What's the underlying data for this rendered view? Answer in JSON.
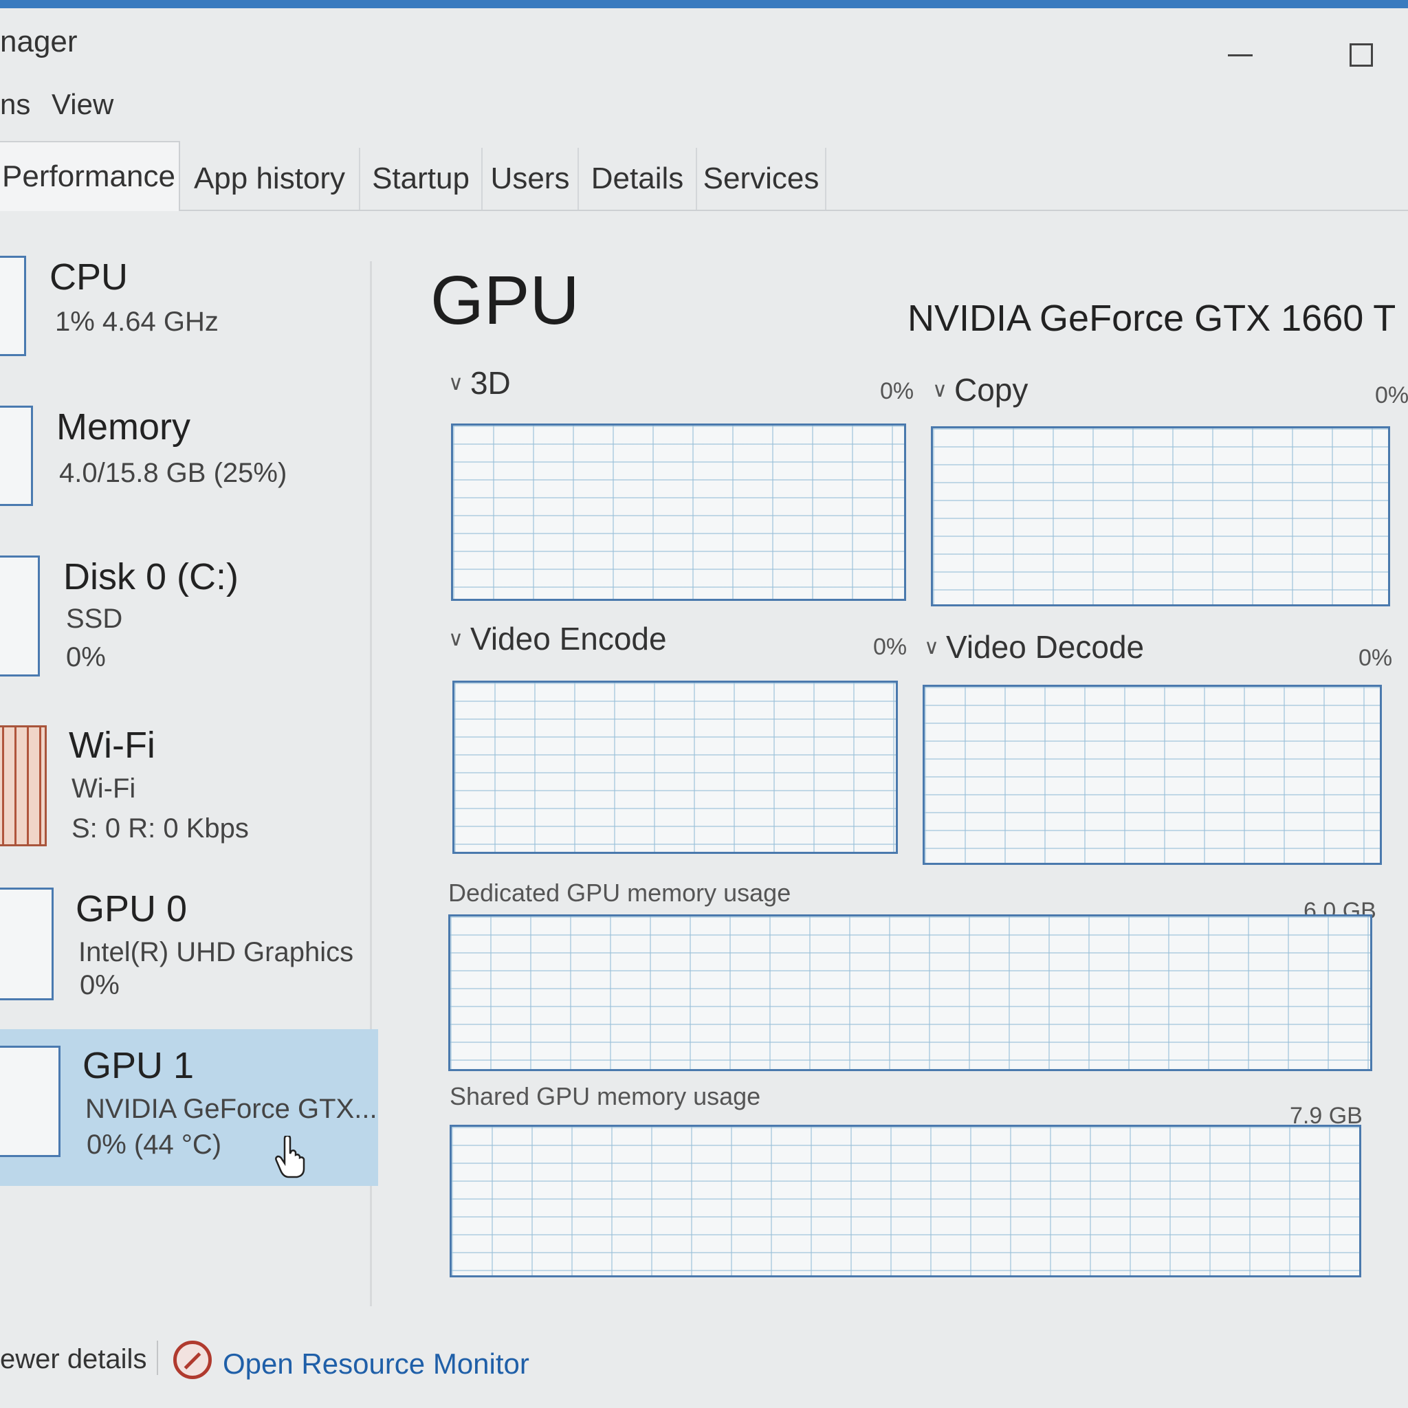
{
  "window": {
    "title": "nager",
    "minimize_icon": "minimize-icon",
    "maximize_icon": "maximize-icon"
  },
  "menu": {
    "options_partial": "ns",
    "view": "View"
  },
  "tabs": [
    {
      "label": "Performance",
      "active": true
    },
    {
      "label": "App history"
    },
    {
      "label": "Startup"
    },
    {
      "label": "Users"
    },
    {
      "label": "Details"
    },
    {
      "label": "Services"
    }
  ],
  "sidebar": {
    "items": [
      {
        "name": "CPU",
        "line1": "1% 4.64 GHz",
        "line2": ""
      },
      {
        "name": "Memory",
        "line1": "4.0/15.8 GB (25%)",
        "line2": ""
      },
      {
        "name": "Disk 0 (C:)",
        "line1": "SSD",
        "line2": "0%"
      },
      {
        "name": "Wi-Fi",
        "line1": "Wi-Fi",
        "line2": "S: 0 R: 0 Kbps"
      },
      {
        "name": "GPU 0",
        "line1": "Intel(R) UHD Graphics",
        "line2": "0%"
      },
      {
        "name": "GPU 1",
        "line1": "NVIDIA GeForce GTX...",
        "line2": "0%  (44 °C)",
        "selected": true
      }
    ]
  },
  "detail": {
    "title": "GPU",
    "model": "NVIDIA GeForce GTX 1660 T",
    "engines": [
      {
        "label": "3D",
        "percent": "0%"
      },
      {
        "label": "Copy",
        "percent": "0%"
      },
      {
        "label": "Video Encode",
        "percent": "0%"
      },
      {
        "label": "Video Decode",
        "percent": "0%"
      }
    ],
    "dedicated_memory": {
      "label": "Dedicated GPU memory usage",
      "max": "6.0 GB"
    },
    "shared_memory": {
      "label": "Shared GPU memory usage",
      "max": "7.9 GB"
    }
  },
  "footer": {
    "fewer_details": "ewer details",
    "open_resource_monitor": "Open Resource Monitor",
    "resource_icon": "resource-monitor-icon"
  },
  "colors": {
    "accent": "#3a7bbf",
    "graph_border": "#4a79ad",
    "selected_bg": "#bcd7ea",
    "link": "#1f5fa8"
  }
}
